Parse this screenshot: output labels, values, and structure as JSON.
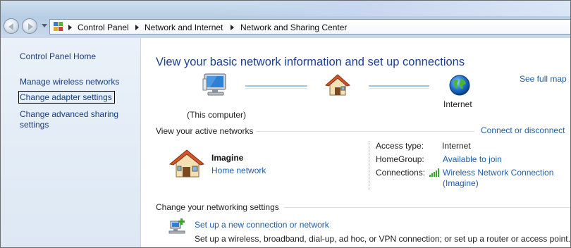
{
  "breadcrumb": [
    "Control Panel",
    "Network and Internet",
    "Network and Sharing Center"
  ],
  "sidebar": {
    "home": "Control Panel Home",
    "items": [
      "Manage wireless networks",
      "Change adapter settings",
      "Change advanced sharing",
      "settings"
    ]
  },
  "main": {
    "title": "View your basic network information and set up connections",
    "see_full_map": "See full map",
    "map": {
      "computer_label": "(This computer)",
      "internet_label": "Internet"
    },
    "active_networks": {
      "heading": "View your active networks",
      "connect_link": "Connect or disconnect",
      "network_name": "Imagine",
      "network_type": "Home network",
      "access_type_label": "Access type:",
      "access_type_value": "Internet",
      "homegroup_label": "HomeGroup:",
      "homegroup_value": "Available to join",
      "connections_label": "Connections:",
      "connection_line1": "Wireless Network Connection",
      "connection_line2": "(Imagine)"
    },
    "settings": {
      "heading": "Change your networking settings",
      "setup_link": "Set up a new connection or network",
      "setup_desc": "Set up a wireless, broadband, dial-up, ad hoc, or VPN connection; or set up a router or access point."
    }
  },
  "colors": {
    "link": "#1f5ea8",
    "title": "#1c3f8f",
    "nav_link": "#1b3f7a"
  }
}
